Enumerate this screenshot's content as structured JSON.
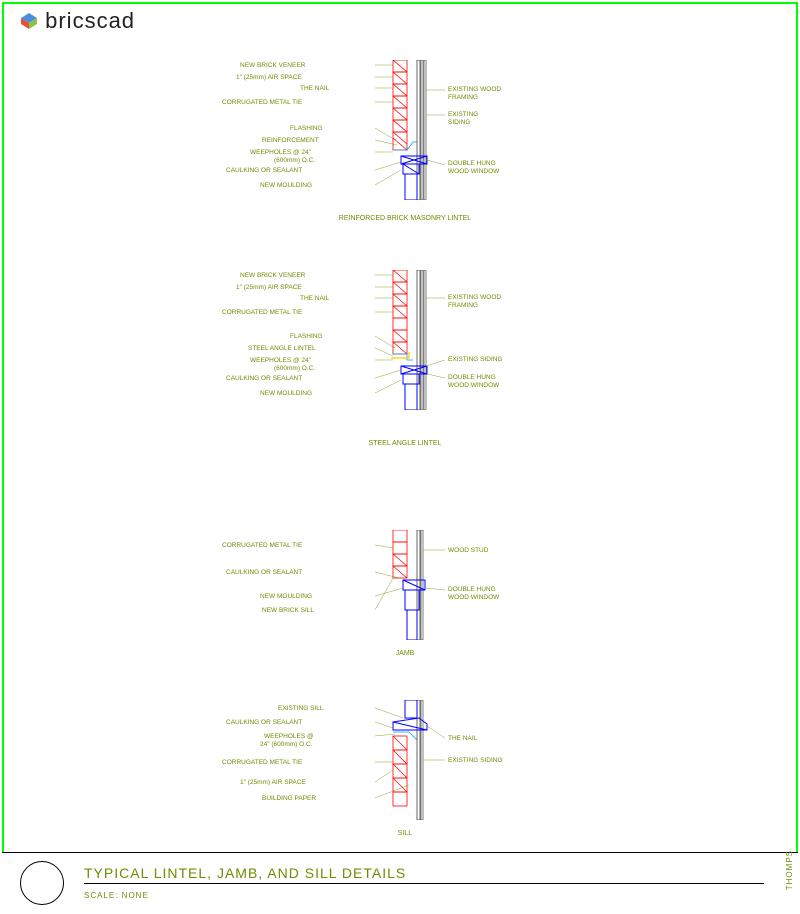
{
  "logo_text": "bricscad",
  "title": "TYPICAL LINTEL, JAMB, AND SILL DETAILS",
  "scale": "SCALE: NONE",
  "side_label": "THOMPS",
  "detail1": {
    "subtitle": "REINFORCED BRICK MASONRY LINTEL",
    "l1": "NEW BRICK VENEER",
    "l2": "1\" (25mm) AIR SPACE",
    "l3": "THE NAIL",
    "l4": "CORRUGATED METAL TIE",
    "l5": "FLASHING",
    "l6": "REINFORCEMENT",
    "l7": "WEEPHOLES @ 24\"",
    "l8": "(600mm) O.C.",
    "l9": "CAULKING OR SEALANT",
    "l10": "NEW MOULDING",
    "r1": "EXISTING WOOD",
    "r1b": "FRAMING",
    "r2": "EXISTING",
    "r2b": "SIDING",
    "r3": "DOUBLE HUNG",
    "r3b": "WOOD WINDOW"
  },
  "detail2": {
    "subtitle": "STEEL ANGLE LINTEL",
    "l1": "NEW BRICK VENEER",
    "l2": "1\" (25mm) AIR SPACE",
    "l3": "THE NAIL",
    "l4": "CORRUGATED METAL TIE",
    "l5": "FLASHING",
    "l6": "STEEL ANGLE LINTEL",
    "l7": "WEEPHOLES @ 24\"",
    "l8": "(600mm) O.C.",
    "l9": "CAULKING OR SEALANT",
    "l10": "NEW MOULDING",
    "r1": "EXISTING WOOD",
    "r1b": "FRAMING",
    "r2": "EXISTING SIDING",
    "r3": "DOUBLE HUNG",
    "r3b": "WOOD WINDOW"
  },
  "detail3": {
    "subtitle": "JAMB",
    "l1": "CORRUGATED METAL TIE",
    "l2": "CAULKING OR SEALANT",
    "l3": "NEW MOULDING",
    "l4": "NEW BRICK SILL",
    "r1": "WOOD STUD",
    "r2": "DOUBLE HUNG",
    "r2b": "WOOD WINDOW"
  },
  "detail4": {
    "subtitle": "SILL",
    "l1": "EXISTING SILL",
    "l2": "CAULKING OR SEALANT",
    "l3": "WEEPHOLES @",
    "l3b": "24\" (600mm) O.C.",
    "l4": "CORRUGATED METAL TIE",
    "l5": "1\" (25mm) AIR SPACE",
    "l6": "BUILDING PAPER",
    "r1": "THE NAIL",
    "r2": "EXISTING SIDING"
  }
}
